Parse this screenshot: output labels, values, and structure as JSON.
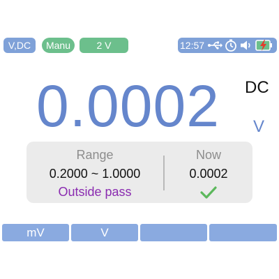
{
  "status_bar": {
    "mode": "V,DC",
    "range_mode": "Manu",
    "range": "2 V",
    "clock": "12:57",
    "icons": [
      "usb-icon",
      "timer-icon",
      "speaker-icon",
      "battery-charging-icon"
    ]
  },
  "reading": {
    "value": "0.0002",
    "coupling": "DC",
    "unit": "V"
  },
  "compare_panel": {
    "range_label": "Range",
    "range_value": "0.2000 ~ 1.0000",
    "status": "Outside pass",
    "now_label": "Now",
    "now_value": "0.0002",
    "indicator_icon": "check-icon"
  },
  "softkeys": [
    "mV",
    "V",
    "",
    ""
  ],
  "colors": {
    "accent_blue": "#6586cc",
    "pill_blue": "#7fa1d8",
    "pill_green": "#6cbf8c",
    "status_purple": "#8a2bb0",
    "check_green": "#5cb85c"
  }
}
